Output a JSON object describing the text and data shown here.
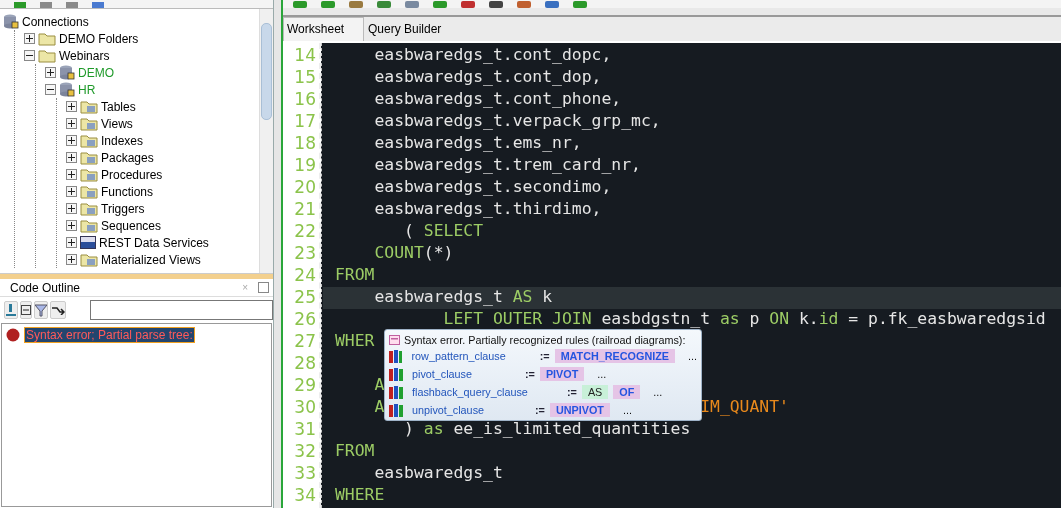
{
  "tree": [
    {
      "label": "Connections",
      "kind": "root",
      "children": [
        {
          "label": "DEMO Folders",
          "kind": "folder",
          "expanded": false
        },
        {
          "label": "Webinars",
          "kind": "folder",
          "expanded": true,
          "children": [
            {
              "label": "DEMO",
              "kind": "connection",
              "connected": true,
              "expanded": false
            },
            {
              "label": "HR",
              "kind": "connection",
              "connected": true,
              "expanded": true,
              "children": [
                {
                  "label": "Tables",
                  "kind": "node",
                  "expanded": false
                },
                {
                  "label": "Views",
                  "kind": "node",
                  "expanded": false
                },
                {
                  "label": "Indexes",
                  "kind": "node",
                  "expanded": false
                },
                {
                  "label": "Packages",
                  "kind": "node",
                  "expanded": false
                },
                {
                  "label": "Procedures",
                  "kind": "node",
                  "expanded": false
                },
                {
                  "label": "Functions",
                  "kind": "node",
                  "expanded": false
                },
                {
                  "label": "Triggers",
                  "kind": "node",
                  "expanded": false
                },
                {
                  "label": "Sequences",
                  "kind": "node",
                  "expanded": false
                },
                {
                  "label": "REST Data Services",
                  "kind": "rest",
                  "expanded": false
                },
                {
                  "label": "Materialized Views",
                  "kind": "node",
                  "expanded": false
                }
              ]
            }
          ]
        }
      ]
    }
  ],
  "code_outline": {
    "title": "Code Outline",
    "close": "×",
    "items": [
      {
        "label": "Syntax error; Partial parse tree:",
        "selected": true
      }
    ]
  },
  "tabs": [
    {
      "label": "Worksheet",
      "selected": true
    },
    {
      "label": "Query Builder",
      "selected": false
    }
  ],
  "code_lines": [
    {
      "number": "14",
      "tokens": [
        {
          "text": "    easbwaredgs_t.cont_dopc,",
          "kind": "plain"
        }
      ]
    },
    {
      "number": "15",
      "tokens": [
        {
          "text": "    easbwaredgs_t.cont_dop,",
          "kind": "plain"
        }
      ]
    },
    {
      "number": "16",
      "tokens": [
        {
          "text": "    easbwaredgs_t.cont_phone,",
          "kind": "plain"
        }
      ]
    },
    {
      "number": "17",
      "tokens": [
        {
          "text": "    easbwaredgs_t.verpack_grp_mc,",
          "kind": "plain"
        }
      ]
    },
    {
      "number": "18",
      "tokens": [
        {
          "text": "    easbwaredgs_t.ems_nr,",
          "kind": "plain"
        }
      ]
    },
    {
      "number": "19",
      "tokens": [
        {
          "text": "    easbwaredgs_t.trem_card_nr,",
          "kind": "plain"
        }
      ]
    },
    {
      "number": "20",
      "tokens": [
        {
          "text": "    easbwaredgs_t.secondimo,",
          "kind": "plain"
        }
      ]
    },
    {
      "number": "21",
      "tokens": [
        {
          "text": "    easbwaredgs_t.thirdimo,",
          "kind": "plain"
        }
      ]
    },
    {
      "number": "22",
      "tokens": [
        {
          "text": "       (",
          "kind": "plain"
        },
        {
          "text": " SELECT",
          "kind": "keyword"
        }
      ]
    },
    {
      "number": "23",
      "tokens": [
        {
          "text": "    COUNT",
          "kind": "keyword"
        },
        {
          "text": "(*)",
          "kind": "plain"
        }
      ]
    },
    {
      "number": "24",
      "tokens": [
        {
          "text": "FROM",
          "kind": "keyword"
        }
      ]
    },
    {
      "number": "25",
      "current": true,
      "tokens": [
        {
          "text": "    easbwaredgs_t",
          "kind": "plain"
        },
        {
          "text": " AS",
          "kind": "keyword"
        },
        {
          "text": " k",
          "kind": "plain"
        }
      ]
    },
    {
      "number": "26",
      "tokens": [
        {
          "text": "           LEFT OUTER JOIN",
          "kind": "keyword"
        },
        {
          "text": " easbdgstn_t",
          "kind": "plain"
        },
        {
          "text": " as",
          "kind": "keyword"
        },
        {
          "text": " p",
          "kind": "plain"
        },
        {
          "text": " ON",
          "kind": "keyword"
        },
        {
          "text": " k.",
          "kind": "plain"
        },
        {
          "text": "id",
          "kind": "keyword"
        },
        {
          "text": " = p.fk_easbwaredgsid",
          "kind": "plain"
        }
      ]
    },
    {
      "number": "27",
      "tokens": [
        {
          "text": "WHER",
          "kind": "keyword"
        }
      ]
    },
    {
      "number": "28"
    },
    {
      "number": "29",
      "tokens": [
        {
          "text": "    A",
          "kind": "keyword"
        }
      ]
    },
    {
      "number": "30",
      "tokens": [
        {
          "text": "    A",
          "kind": "keyword"
        },
        {
          "text": "                                IM_QUANT'",
          "kind": "string"
        }
      ]
    },
    {
      "number": "31",
      "tokens": [
        {
          "text": "       )",
          "kind": "plain"
        },
        {
          "text": " as",
          "kind": "keyword"
        },
        {
          "text": " ee_is_limited_quantities",
          "kind": "plain"
        }
      ]
    },
    {
      "number": "32",
      "tokens": [
        {
          "text": "FROM",
          "kind": "keyword"
        }
      ]
    },
    {
      "number": "33",
      "tokens": [
        {
          "text": "    easbwaredgs_t",
          "kind": "plain"
        }
      ]
    },
    {
      "number": "34",
      "tokens": [
        {
          "text": "WHERE",
          "kind": "keyword"
        }
      ]
    }
  ],
  "popup": {
    "title": "Syntax error. Partially recognized rules (railroad diagrams):",
    "rules": [
      {
        "name": "row_pattern_clause",
        "operator": ":=",
        "tokens": [
          {
            "text": "MATCH_RECOGNIZE",
            "kind": "keyword"
          }
        ],
        "more": "..."
      },
      {
        "name": "pivot_clause",
        "operator": ":=",
        "tokens": [
          {
            "text": "PIVOT",
            "kind": "keyword"
          }
        ],
        "more": "..."
      },
      {
        "name": "flashback_query_clause",
        "operator": ":=",
        "tokens": [
          {
            "text": "AS",
            "kind": "optional"
          },
          {
            "text": "OF",
            "kind": "keyword"
          }
        ],
        "more": "..."
      },
      {
        "name": "unpivot_clause",
        "operator": ":=",
        "tokens": [
          {
            "text": "UNPIVOT",
            "kind": "keyword"
          }
        ],
        "more": "..."
      }
    ]
  }
}
